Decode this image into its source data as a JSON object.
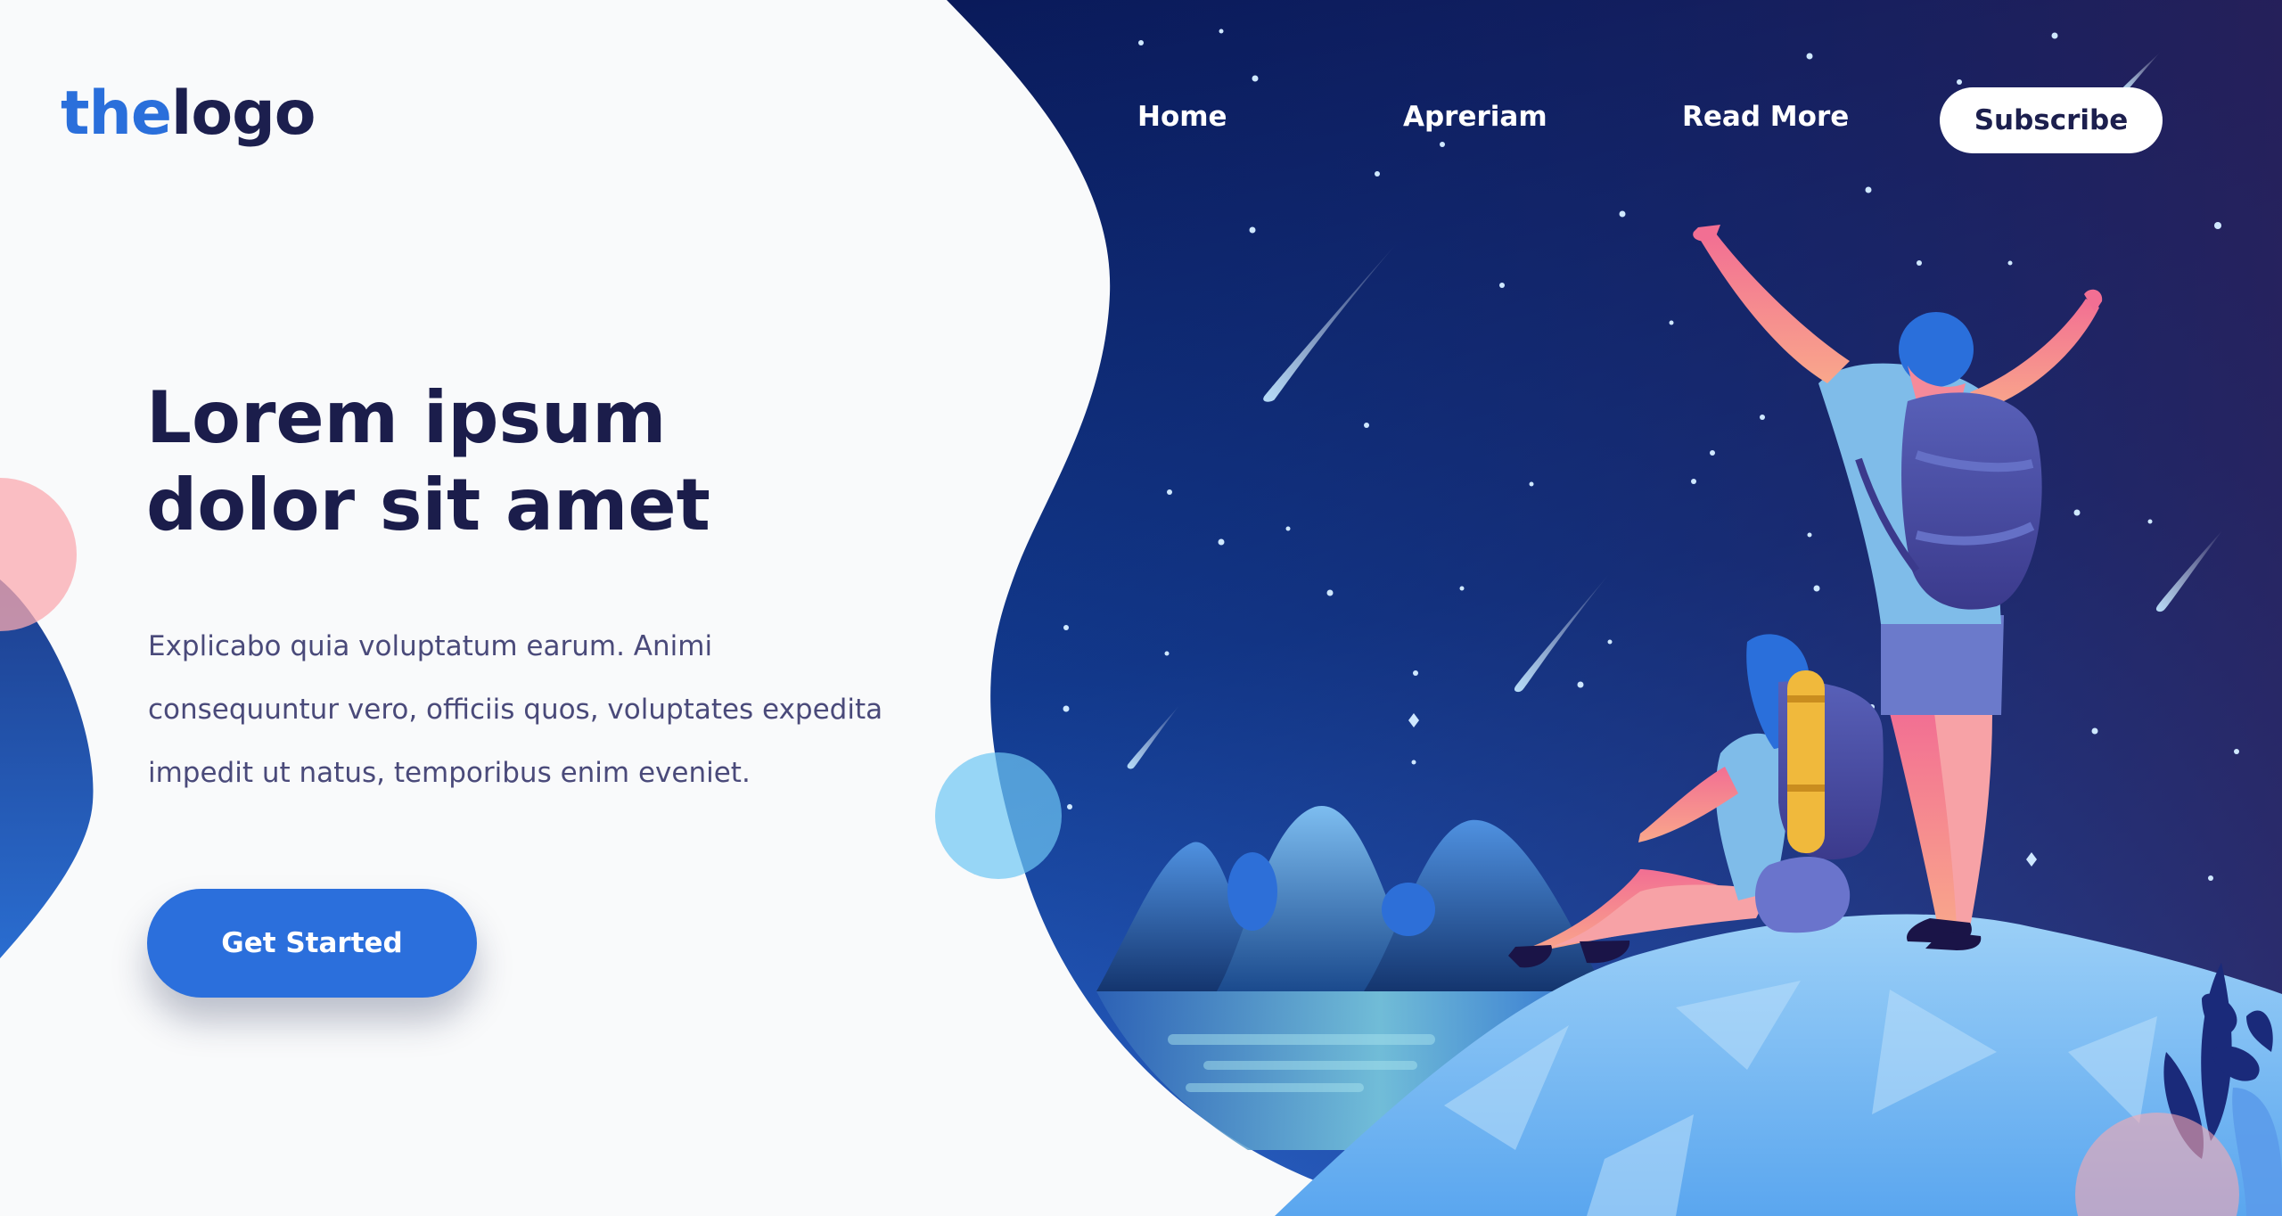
{
  "logo": {
    "part1": "the",
    "part2": "logo"
  },
  "nav": {
    "items": [
      {
        "label": "Home"
      },
      {
        "label": "Apreriam"
      },
      {
        "label": "Read More"
      }
    ],
    "subscribe_label": "Subscribe"
  },
  "hero": {
    "title_line1": "Lorem ipsum",
    "title_line2": "dolor sit amet",
    "text": "Explicabo quia voluptatum earum. Animi consequuntur vero, officiis quos, voluptates expedita impedit ut natus, temporibus enim eveniet.",
    "cta_label": "Get Started"
  },
  "colors": {
    "brand_blue": "#2b6fdc",
    "navy_text": "#1b1d4b",
    "night_sky_top": "#0a1b5c",
    "night_sky_bottom": "#2a6ad8",
    "rock": "#6fb4f2",
    "skin": "#f58a9a"
  },
  "illustration": {
    "name": "stargazing-hikers-illustration",
    "icons": [
      "shooting-star-icon",
      "mountain-icon",
      "hiker-icon",
      "backpack-icon",
      "leaf-icon"
    ]
  }
}
